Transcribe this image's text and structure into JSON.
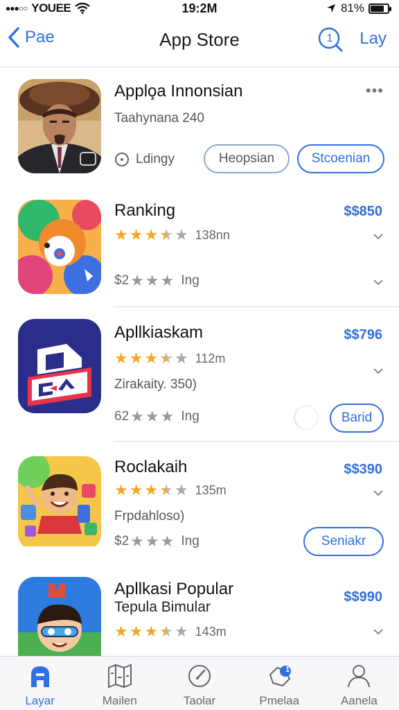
{
  "status_bar": {
    "carrier": "YOUEE",
    "time": "19:2M",
    "battery": "81%",
    "battery_level": 0.81
  },
  "nav": {
    "back_label": "Pae",
    "title": "App Store",
    "search_badge": "1",
    "right_label": "Lay"
  },
  "apps": [
    {
      "title": "Applo̧a Innonsian",
      "subtitle": "Taahynana 240",
      "option_label": "Ldingy",
      "button_secondary": "Heopsian",
      "button_primary": "Stcoenian"
    },
    {
      "title": "Ranking",
      "price": "$$850",
      "rating_count": "138nn",
      "small_rating_prefix": "$2",
      "small_rating_label": "Ing"
    },
    {
      "title": "Apllkiaskam",
      "price": "$$796",
      "rating_count": "112m",
      "subtitle": "Zirakaity. 350)",
      "small_rating_prefix": "62",
      "small_rating_label": "Ing",
      "button": "Barid"
    },
    {
      "title": "Roclakaih",
      "price": "$$390",
      "rating_count": "135m",
      "subtitle": "Frpdahloso)",
      "small_rating_prefix": "$2",
      "small_rating_label": "Ing",
      "button": "Seniakr"
    },
    {
      "title": "Apllkasi Popular",
      "subtitle": "Tepula Bimular",
      "price": "$$990",
      "rating_count": "143m"
    }
  ],
  "tabs": [
    {
      "label": "Layar",
      "icon": "app-store-icon",
      "active": true
    },
    {
      "label": "Mailen",
      "icon": "map-icon"
    },
    {
      "label": "Taolar",
      "icon": "compass-icon"
    },
    {
      "label": "Pmelaa",
      "icon": "updates-badge-icon",
      "badge": "1"
    },
    {
      "label": "Aanela",
      "icon": "person-icon"
    }
  ],
  "colors": {
    "accent": "#2f6fe0",
    "star": "#f5a623"
  }
}
